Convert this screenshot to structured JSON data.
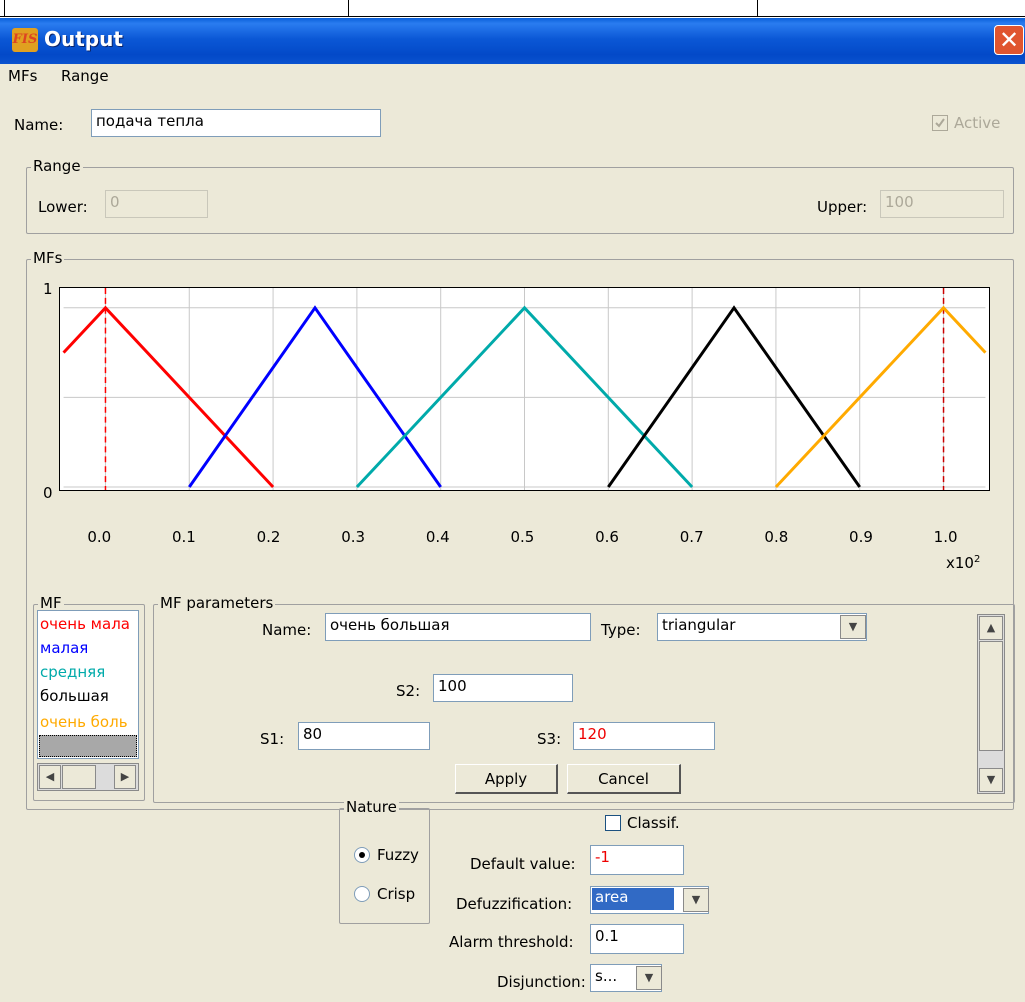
{
  "window": {
    "title": "Output",
    "app_icon": "fis-icon",
    "close_icon": "close-icon"
  },
  "menu": [
    "MFs",
    "Range"
  ],
  "name_field": {
    "label": "Name:",
    "value": "подача тепла"
  },
  "active": {
    "label": "Active",
    "checked": true
  },
  "range": {
    "legend": "Range",
    "lower_label": "Lower:",
    "lower_value": "0",
    "upper_label": "Upper:",
    "upper_value": "100"
  },
  "mfs_group": {
    "legend": "MFs"
  },
  "chart_data": {
    "type": "line",
    "xlim": [
      -0.05,
      1.05
    ],
    "ylim": [
      0,
      1
    ],
    "x_ticks": [
      "0.0",
      "0.1",
      "0.2",
      "0.3",
      "0.4",
      "0.5",
      "0.6",
      "0.7",
      "0.8",
      "0.9",
      "1.0"
    ],
    "y_ticks": [
      "0",
      "1"
    ],
    "multiplier_base": "x10",
    "multiplier_exp": "2",
    "grid": true,
    "series": [
      {
        "name": "очень мала",
        "color": "#ff0000",
        "x": [
          -0.05,
          0.0,
          0.2
        ],
        "y": [
          0.75,
          1,
          0
        ]
      },
      {
        "name": "малая",
        "color": "#0000ff",
        "x": [
          0.1,
          0.25,
          0.4
        ],
        "y": [
          0,
          1,
          0
        ]
      },
      {
        "name": "средняя",
        "color": "#00aaaa",
        "x": [
          0.3,
          0.5,
          0.7
        ],
        "y": [
          0,
          1,
          0
        ]
      },
      {
        "name": "большая",
        "color": "#000000",
        "x": [
          0.6,
          0.75,
          0.9
        ],
        "y": [
          0,
          1,
          0
        ]
      },
      {
        "name": "очень большая",
        "color": "#ffaa00",
        "x": [
          0.8,
          1.0,
          1.05
        ],
        "y": [
          0,
          1,
          0.75
        ]
      }
    ],
    "markers": [
      {
        "x": 0.0,
        "color": "#ff0000"
      },
      {
        "x": 1.0,
        "color": "#cc0000"
      }
    ]
  },
  "mf_list": {
    "legend": "MF",
    "items": [
      {
        "label": "очень мала",
        "color": "#ff0000"
      },
      {
        "label": "малая",
        "color": "#0000ff"
      },
      {
        "label": "средняя",
        "color": "#00aaaa"
      },
      {
        "label": "большая",
        "color": "#000000"
      },
      {
        "label": "очень боль",
        "color": "#ffaa00"
      }
    ]
  },
  "mf_params": {
    "legend": "MF parameters",
    "name_label": "Name:",
    "name_value": "очень большая",
    "type_label": "Type:",
    "type_value": "triangular",
    "s1_label": "S1:",
    "s1_value": "80",
    "s2_label": "S2:",
    "s2_value": "100",
    "s3_label": "S3:",
    "s3_value": "120",
    "apply": "Apply",
    "cancel": "Cancel"
  },
  "nature": {
    "legend": "Nature",
    "fuzzy": "Fuzzy",
    "crisp": "Crisp",
    "selected": "Fuzzy"
  },
  "classif": {
    "label": "Classif.",
    "checked": false
  },
  "default_value": {
    "label": "Default value:",
    "value": "-1"
  },
  "defuzzification": {
    "label": "Defuzzification:",
    "value": "area"
  },
  "alarm_threshold": {
    "label": "Alarm threshold:",
    "value": "0.1"
  },
  "disjunction": {
    "label": "Disjunction:",
    "value": "s..."
  },
  "colors": {
    "titlebar": "#0a53cf",
    "background": "#ece9d8",
    "selection": "#316ac5"
  }
}
